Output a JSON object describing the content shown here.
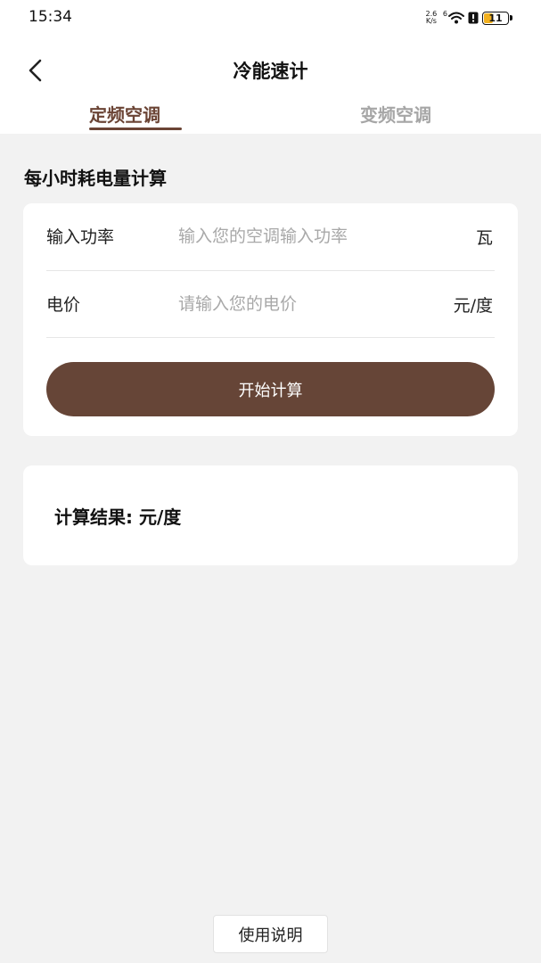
{
  "status_bar": {
    "time": "15:34",
    "net_speed_value": "2.6",
    "net_speed_unit": "K/s",
    "wifi_label": "6",
    "battery_level": "11",
    "battery_color": "#f2b01e"
  },
  "header": {
    "title": "冷能速计",
    "back_icon": "chevron-left-icon"
  },
  "tabs": [
    {
      "label": "定频空调",
      "active": true
    },
    {
      "label": "变频空调",
      "active": false
    }
  ],
  "section": {
    "title": "每小时耗电量计算"
  },
  "form": {
    "power": {
      "label": "输入功率",
      "placeholder": "输入您的空调输入功率",
      "value": "",
      "unit": "瓦"
    },
    "price": {
      "label": "电价",
      "placeholder": "请输入您的电价",
      "value": "",
      "unit": "元/度"
    },
    "submit_label": "开始计算"
  },
  "result": {
    "text": "计算结果:  元/度"
  },
  "footer": {
    "help_label": "使用说明"
  },
  "colors": {
    "accent": "#6b4435",
    "button": "#664537",
    "background": "#f2f2f2"
  }
}
